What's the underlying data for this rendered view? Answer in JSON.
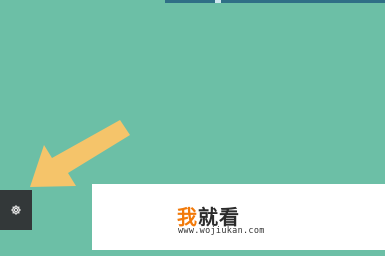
{
  "watermark": {
    "brand_char_1": "我",
    "brand_rest": "就看",
    "url": "www.wojiukan.com"
  },
  "colors": {
    "background": "#6cbfa6",
    "arrow": "#f5c46a",
    "settings_button": "#333839",
    "brand_orange": "#f27a0a"
  },
  "icons": {
    "settings": "gear-icon",
    "pointer": "arrow-icon"
  }
}
